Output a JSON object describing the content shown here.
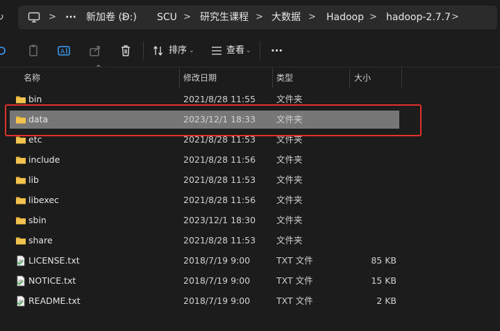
{
  "address_bar": {
    "overflow_label": "···",
    "crumbs": [
      "新加卷 (D:)",
      "SCU",
      "研究生课程",
      "大数据",
      "Hadoop",
      "hadoop-2.7.7"
    ],
    "separator": ">"
  },
  "toolbar": {
    "sort_label": "排序",
    "view_label": "查看",
    "more_label": "···"
  },
  "columns": {
    "name": "名称",
    "modified": "修改日期",
    "type": "类型",
    "size": "大小"
  },
  "files": [
    {
      "name": "bin",
      "modified": "2021/8/28 11:55",
      "type": "文件夹",
      "size": "",
      "kind": "folder"
    },
    {
      "name": "data",
      "modified": "2023/12/1 18:33",
      "type": "文件夹",
      "size": "",
      "kind": "folder",
      "selected": true
    },
    {
      "name": "etc",
      "modified": "2021/8/28 11:53",
      "type": "文件夹",
      "size": "",
      "kind": "folder"
    },
    {
      "name": "include",
      "modified": "2021/8/28 11:56",
      "type": "文件夹",
      "size": "",
      "kind": "folder"
    },
    {
      "name": "lib",
      "modified": "2021/8/28 11:53",
      "type": "文件夹",
      "size": "",
      "kind": "folder"
    },
    {
      "name": "libexec",
      "modified": "2021/8/28 11:56",
      "type": "文件夹",
      "size": "",
      "kind": "folder"
    },
    {
      "name": "sbin",
      "modified": "2023/12/1 18:30",
      "type": "文件夹",
      "size": "",
      "kind": "folder"
    },
    {
      "name": "share",
      "modified": "2021/8/28 11:53",
      "type": "文件夹",
      "size": "",
      "kind": "folder"
    },
    {
      "name": "LICENSE.txt",
      "modified": "2018/7/19 9:00",
      "type": "TXT 文件",
      "size": "85 KB",
      "kind": "txt"
    },
    {
      "name": "NOTICE.txt",
      "modified": "2018/7/19 9:00",
      "type": "TXT 文件",
      "size": "15 KB",
      "kind": "txt"
    },
    {
      "name": "README.txt",
      "modified": "2018/7/19 9:00",
      "type": "TXT 文件",
      "size": "2 KB",
      "kind": "txt"
    }
  ],
  "colors": {
    "background": "#1c1c1c",
    "selection": "#777777",
    "highlight_border": "#e0312b",
    "folder_yellow": "#f3c34d"
  }
}
